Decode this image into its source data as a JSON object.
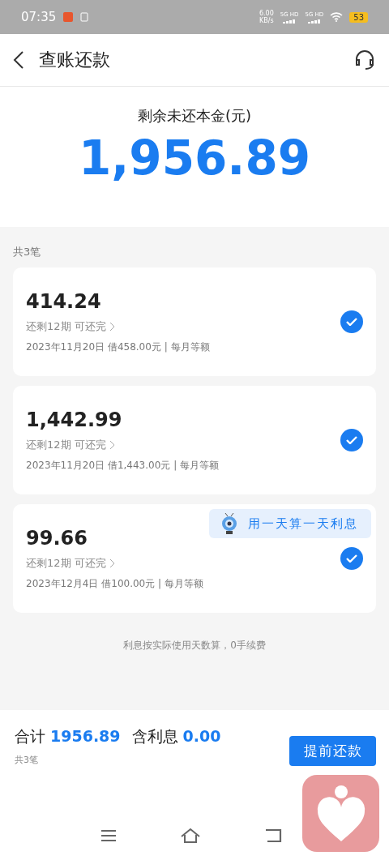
{
  "status_bar": {
    "time": "07:35",
    "net_speed": "6.00",
    "net_unit": "KB/s",
    "signals": [
      "5G HD",
      "5G HD"
    ],
    "battery": "53"
  },
  "header": {
    "title": "查账还款"
  },
  "summary": {
    "label": "剩余未还本金(元)",
    "amount": "1,956.89"
  },
  "count_label": "共3笔",
  "loans": [
    {
      "amount": "414.24",
      "remaining": "还剩12期 可还完",
      "detail": "2023年11月20日 借458.00元 | 每月等额",
      "checked": true
    },
    {
      "amount": "1,442.99",
      "remaining": "还剩12期 可还完",
      "detail": "2023年11月20日 借1,443.00元 | 每月等额",
      "checked": true
    },
    {
      "amount": "99.66",
      "remaining": "还剩12期 可还完",
      "detail": "2023年12月4日 借100.00元 | 每月等额",
      "checked": true,
      "badge": "用一天算一天利息"
    }
  ],
  "note": "利息按实际使用天数算，0手续费",
  "footer": {
    "total_label": "合计",
    "total": "1956.89",
    "interest_label": "含利息",
    "interest": "0.00",
    "count": "共3笔",
    "button": "提前还款"
  }
}
